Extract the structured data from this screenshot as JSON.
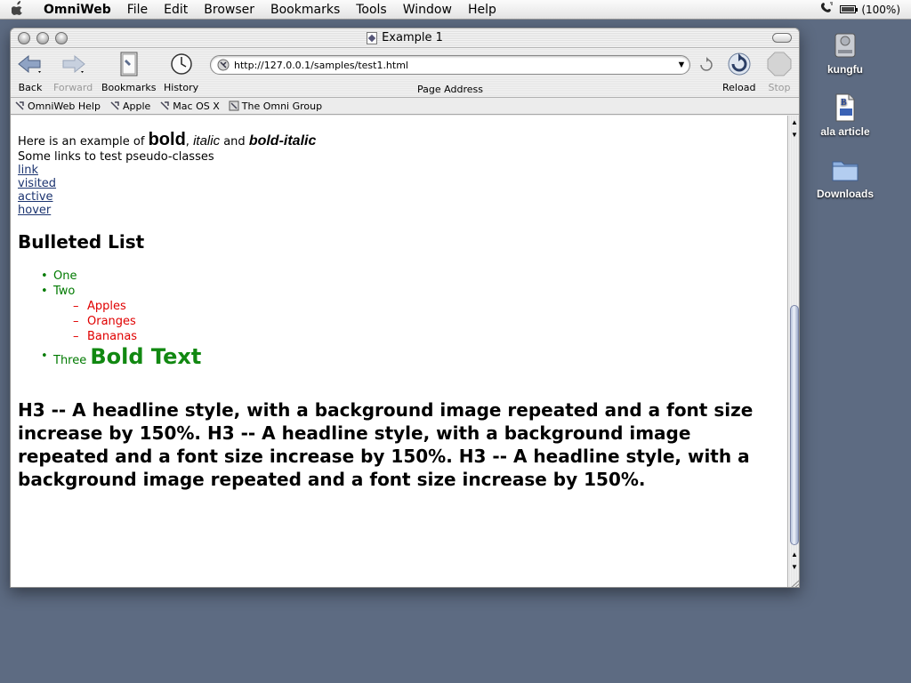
{
  "menubar": {
    "app_name": "OmniWeb",
    "items": [
      "File",
      "Edit",
      "Browser",
      "Bookmarks",
      "Tools",
      "Window",
      "Help"
    ],
    "battery_text": "(100%)",
    "battery_level": 1.0
  },
  "window": {
    "title": "Example 1"
  },
  "toolbar": {
    "back_label": "Back",
    "forward_label": "Forward",
    "bookmarks_label": "Bookmarks",
    "history_label": "History",
    "address_value": "http://127.0.0.1/samples/test1.html",
    "address_label": "Page Address",
    "reload_label": "Reload",
    "stop_label": "Stop"
  },
  "bookmarks_bar": {
    "items": [
      "OmniWeb Help",
      "Apple",
      "Mac OS X",
      "The Omni Group"
    ]
  },
  "page": {
    "intro": {
      "prefix": "Here is an example of ",
      "bold": "bold",
      "comma": ", ",
      "italic": "italic",
      "and": " and ",
      "bold_italic": "bold-italic"
    },
    "links_heading": "Some links to test pseudo-classes",
    "links": [
      "link",
      "visited",
      "active",
      "hover"
    ],
    "list_title": "Bulleted List",
    "list": {
      "one": "One",
      "two": "Two",
      "sub_items": [
        "Apples",
        "Oranges",
        "Bananas"
      ],
      "three": "Three ",
      "bold_text": "Bold Text"
    },
    "h3_text": "H3 -- A headline style, with a background image repeated and a font size increase by 150%. H3 -- A headline style, with a background image repeated and a font size increase by 150%. H3 -- A headline style, with a background image repeated and a font size increase by 150%."
  },
  "desktop": {
    "icons": [
      "kungfu",
      "ala article",
      "Downloads"
    ]
  },
  "colors": {
    "desktop": "#5d6b82",
    "link": "#1c3470",
    "list_green": "#007a00",
    "sublist_red": "#e00000"
  }
}
